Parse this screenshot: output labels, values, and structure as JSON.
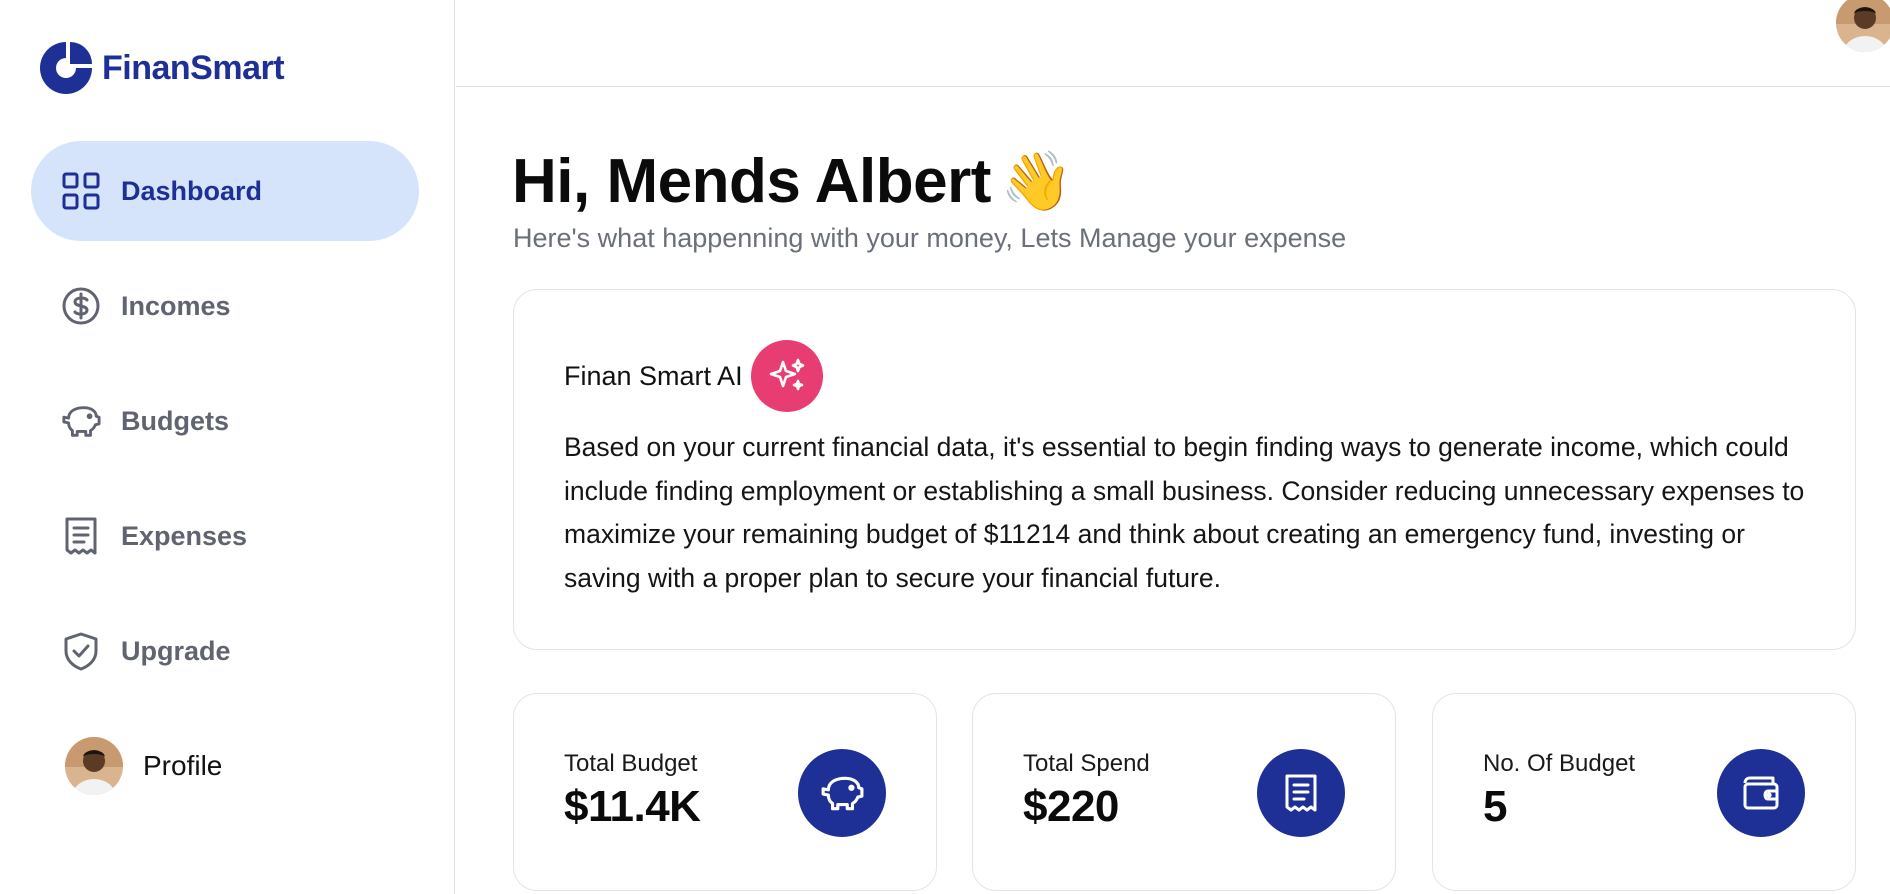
{
  "app": {
    "name": "FinanSmart",
    "brand_color": "#1e2f95",
    "accent_color": "#e83d72",
    "active_nav_bg": "#d6e4fb"
  },
  "sidebar": {
    "items": [
      {
        "label": "Dashboard",
        "icon": "grid-icon",
        "active": true
      },
      {
        "label": "Incomes",
        "icon": "dollar-circle-icon",
        "active": false
      },
      {
        "label": "Budgets",
        "icon": "piggy-bank-icon",
        "active": false
      },
      {
        "label": "Expenses",
        "icon": "receipt-icon",
        "active": false
      },
      {
        "label": "Upgrade",
        "icon": "shield-check-icon",
        "active": false
      },
      {
        "label": "Profile",
        "icon": "avatar",
        "active": false
      }
    ]
  },
  "main": {
    "greeting": "Hi, Mends Albert",
    "greeting_emoji": "👋",
    "subtitle": "Here's what happenning with your money, Lets Manage your expense",
    "ai_card": {
      "title": "Finan Smart AI",
      "icon": "sparkles-icon",
      "text": "Based on your current financial data, it's essential to begin finding ways to generate income, which could include finding employment or establishing a small business. Consider reducing unnecessary expenses to maximize your remaining budget of $11214 and think about creating an emergency fund, investing or saving with a proper plan to secure your financial future."
    },
    "stats": [
      {
        "label": "Total Budget",
        "value": "$11.4K",
        "icon": "piggy-bank-icon"
      },
      {
        "label": "Total Spend",
        "value": "$220",
        "icon": "receipt-icon"
      },
      {
        "label": "No. Of Budget",
        "value": "5",
        "icon": "wallet-icon"
      }
    ]
  }
}
